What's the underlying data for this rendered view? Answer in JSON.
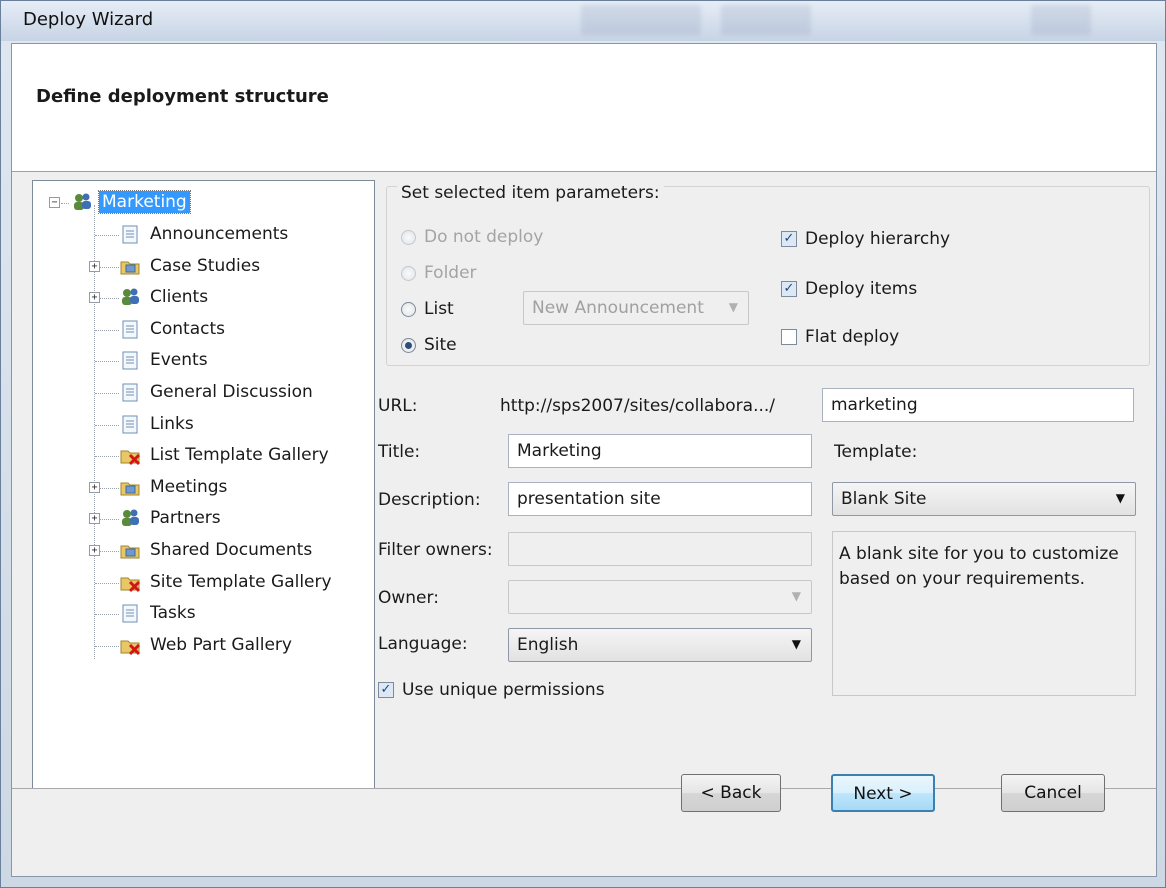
{
  "window": {
    "title": "Deploy Wizard"
  },
  "header": {
    "title": "Define deployment structure"
  },
  "tree": {
    "root": "Marketing",
    "items": [
      {
        "label": "Announcements",
        "icon": "list-icon",
        "expandable": false
      },
      {
        "label": "Case Studies",
        "icon": "library-folder-icon",
        "expandable": true
      },
      {
        "label": "Clients",
        "icon": "site-people-icon",
        "expandable": true
      },
      {
        "label": "Contacts",
        "icon": "list-icon",
        "expandable": false
      },
      {
        "label": "Events",
        "icon": "list-icon",
        "expandable": false
      },
      {
        "label": "General Discussion",
        "icon": "list-icon",
        "expandable": false
      },
      {
        "label": "Links",
        "icon": "list-icon",
        "expandable": false
      },
      {
        "label": "List Template Gallery",
        "icon": "gallery-excluded-icon",
        "expandable": false
      },
      {
        "label": "Meetings",
        "icon": "library-folder-icon",
        "expandable": true
      },
      {
        "label": "Partners",
        "icon": "site-people-icon",
        "expandable": true
      },
      {
        "label": "Shared Documents",
        "icon": "library-folder-icon",
        "expandable": true
      },
      {
        "label": "Site Template Gallery",
        "icon": "gallery-excluded-icon",
        "expandable": false
      },
      {
        "label": "Tasks",
        "icon": "list-icon",
        "expandable": false
      },
      {
        "label": "Web Part Gallery",
        "icon": "gallery-excluded-icon",
        "expandable": false
      }
    ]
  },
  "params": {
    "group_label": "Set selected item parameters:",
    "do_not_deploy": "Do not deploy",
    "folder": "Folder",
    "list": "List",
    "site": "Site",
    "list_template": "New Announcement",
    "deploy_hierarchy": "Deploy hierarchy",
    "deploy_items": "Deploy items",
    "flat_deploy": "Flat deploy"
  },
  "form": {
    "url_label": "URL:",
    "url_base": "http://sps2007/sites/collabora.../",
    "url_value": "marketing",
    "title_label": "Title:",
    "title_value": "Marketing",
    "template_label": "Template:",
    "description_label": "Description:",
    "description_value": "presentation site",
    "template_value": "Blank Site",
    "template_description": "A blank site for you to customize based on your requirements.",
    "filter_owners_label": "Filter owners:",
    "owner_label": "Owner:",
    "language_label": "Language:",
    "language_value": "English",
    "unique_permissions": "Use unique permissions"
  },
  "buttons": {
    "back": "< Back",
    "next": "Next >",
    "cancel": "Cancel"
  },
  "colors": {
    "selection": "#3399ff",
    "default_button_border": "#3c7fb1"
  }
}
